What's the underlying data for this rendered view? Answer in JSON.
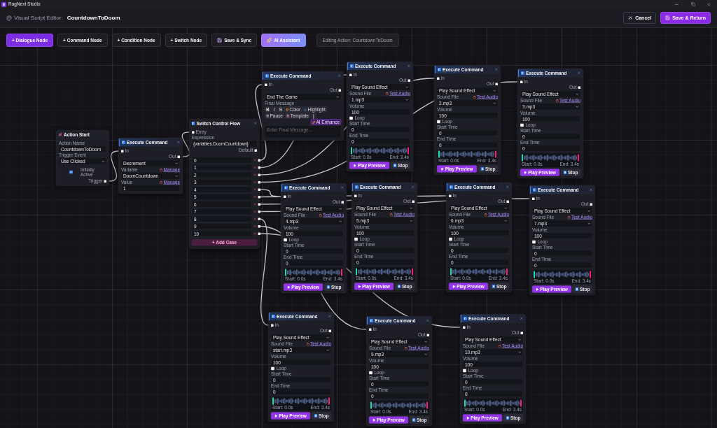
{
  "title_bar": {
    "app_name": "RagNext Studio"
  },
  "header": {
    "label": "Visual Script Editor:",
    "script_name": "CountdownToDoom",
    "buttons": [
      {
        "label": "Cancel",
        "kind": "cancel"
      },
      {
        "label": "Save & Return",
        "kind": "save"
      }
    ]
  },
  "toolbar": {
    "buttons": [
      {
        "label": "+ Dialogue Node",
        "kind": "primary"
      },
      {
        "label": "+ Command Node",
        "kind": "plain"
      },
      {
        "label": "+ Condition Node",
        "kind": "plain"
      },
      {
        "label": "+ Switch Node",
        "kind": "plain"
      },
      {
        "label": "Save & Sync",
        "kind": "save"
      },
      {
        "label": "AI Assistant",
        "kind": "ai"
      }
    ],
    "status": "Editing Action: CountdownToDoom"
  },
  "canvas": {
    "nodes": [
      {
        "kind": "start",
        "title": "Action Start",
        "output": "Trigger",
        "fields": [
          {
            "kind": "input",
            "label": "Action Name",
            "value": "CountdownToDoom"
          },
          {
            "kind": "select",
            "label": "Trigger Event",
            "value": "Use Clicked"
          },
          {
            "kind": "flag",
            "label": "Initially Active",
            "checked": true
          }
        ]
      },
      {
        "kind": "command",
        "title": "Execute Command",
        "input": "In",
        "output": "Out",
        "fields": [
          {
            "kind": "select",
            "value": "Decrement"
          },
          {
            "kind": "select",
            "label": "Variable",
            "link": "Manage",
            "value": "DoomCountdown"
          },
          {
            "kind": "input",
            "label": "Value",
            "link": "Manage",
            "value": "1"
          }
        ]
      },
      {
        "kind": "switch",
        "title": "Switch Control Flow",
        "input": "Entry",
        "default_output": "Default",
        "fields": [
          {
            "kind": "input",
            "label": "Expression",
            "value": "{variables.DoomCountdown}"
          }
        ],
        "cases": [
          "0",
          "1",
          "2",
          "3",
          "4",
          "5",
          "6",
          "7",
          "8",
          "9",
          "10"
        ],
        "add_button": "+ Add Case"
      },
      {
        "kind": "command",
        "title": "Execute Command",
        "input": "In",
        "output": "Out",
        "fields": [
          {
            "kind": "select",
            "value": "End The Game"
          },
          {
            "kind": "rich_text",
            "label": "Final Message",
            "placeholder": "Enter Final Message...",
            "tools": [
              {
                "label": "B",
                "kind": "bold"
              },
              {
                "label": "I",
                "kind": "italic"
              },
              {
                "label": "S",
                "kind": "strike"
              },
              {
                "label": "Color",
                "kind": "color"
              },
              {
                "label": "Highlight",
                "kind": "highlight"
              },
              {
                "label": "Pause",
                "kind": "pause"
              },
              {
                "label": "Template",
                "kind": "template"
              },
              {
                "label": "|",
                "kind": "plain"
              },
              {
                "label": "AI Enhance",
                "kind": "ai"
              }
            ]
          }
        ]
      },
      {
        "kind": "command",
        "title": "Execute Command",
        "input": "In",
        "output": "Out",
        "fields": [
          {
            "kind": "select",
            "value": "Play Sound Effect"
          },
          {
            "kind": "select",
            "label": "Sound File",
            "link": "Test Audio",
            "value": "1.mp3"
          },
          {
            "kind": "input",
            "label": "Volume",
            "value": "100"
          },
          {
            "kind": "checkbox",
            "label": "Loop",
            "checked": false
          },
          {
            "kind": "input",
            "label": "Start Time",
            "value": "0"
          },
          {
            "kind": "input",
            "label": "End Time",
            "value": "0"
          },
          {
            "kind": "waveform",
            "start_label": "Start: 0.0s",
            "end_label": "End: 3.4s"
          },
          {
            "kind": "actions",
            "buttons": [
              {
                "label": "Play Preview",
                "kind": "play"
              },
              {
                "label": "Stop",
                "kind": "stop"
              }
            ]
          }
        ]
      },
      {
        "kind": "command",
        "title": "Execute Command",
        "input": "In",
        "output": "Out",
        "fields": [
          {
            "kind": "select",
            "value": "Play Sound Effect"
          },
          {
            "kind": "select",
            "label": "Sound File",
            "link": "Test Audio",
            "value": "2.mp3"
          },
          {
            "kind": "input",
            "label": "Volume",
            "value": "100"
          },
          {
            "kind": "checkbox",
            "label": "Loop",
            "checked": false
          },
          {
            "kind": "input",
            "label": "Start Time",
            "value": "0"
          },
          {
            "kind": "input",
            "label": "End Time",
            "value": "0"
          },
          {
            "kind": "waveform",
            "start_label": "Start: 0.0s",
            "end_label": "End: 3.4s"
          },
          {
            "kind": "actions",
            "buttons": [
              {
                "label": "Play Preview",
                "kind": "play"
              },
              {
                "label": "Stop",
                "kind": "stop"
              }
            ]
          }
        ]
      },
      {
        "kind": "command",
        "title": "Execute Command",
        "input": "In",
        "output": "Out",
        "fields": [
          {
            "kind": "select",
            "value": "Play Sound Effect"
          },
          {
            "kind": "select",
            "label": "Sound File",
            "link": "Test Audio",
            "value": "3.mp3"
          },
          {
            "kind": "input",
            "label": "Volume",
            "value": "100"
          },
          {
            "kind": "checkbox",
            "label": "Loop",
            "checked": false
          },
          {
            "kind": "input",
            "label": "Start Time",
            "value": "0"
          },
          {
            "kind": "input",
            "label": "End Time",
            "value": "0"
          },
          {
            "kind": "waveform",
            "start_label": "Start: 0.0s",
            "end_label": "End: 3.4s"
          },
          {
            "kind": "actions",
            "buttons": [
              {
                "label": "Play Preview",
                "kind": "play"
              },
              {
                "label": "Stop",
                "kind": "stop"
              }
            ]
          }
        ]
      },
      {
        "kind": "command",
        "title": "Execute Command",
        "input": "In",
        "output": "Out",
        "fields": [
          {
            "kind": "select",
            "value": "Play Sound Effect"
          },
          {
            "kind": "select",
            "label": "Sound File",
            "link": "Test Audio",
            "value": "4.mp3"
          },
          {
            "kind": "input",
            "label": "Volume",
            "value": "100"
          },
          {
            "kind": "checkbox",
            "label": "Loop",
            "checked": false
          },
          {
            "kind": "input",
            "label": "Start Time",
            "value": "0"
          },
          {
            "kind": "input",
            "label": "End Time",
            "value": "0"
          },
          {
            "kind": "waveform",
            "start_label": "Start: 0.0s",
            "end_label": "End: 3.4s"
          },
          {
            "kind": "actions",
            "buttons": [
              {
                "label": "Play Preview",
                "kind": "play"
              },
              {
                "label": "Stop",
                "kind": "stop"
              }
            ]
          }
        ]
      },
      {
        "kind": "command",
        "title": "Execute Command",
        "input": "In",
        "output": "Out",
        "fields": [
          {
            "kind": "select",
            "value": "Play Sound Effect"
          },
          {
            "kind": "select",
            "label": "Sound File",
            "link": "Test Audio",
            "value": "5.mp3"
          },
          {
            "kind": "input",
            "label": "Volume",
            "value": "100"
          },
          {
            "kind": "checkbox",
            "label": "Loop",
            "checked": false
          },
          {
            "kind": "input",
            "label": "Start Time",
            "value": "0"
          },
          {
            "kind": "input",
            "label": "End Time",
            "value": "0"
          },
          {
            "kind": "waveform",
            "start_label": "Start: 0.0s",
            "end_label": "End: 3.4s"
          },
          {
            "kind": "actions",
            "buttons": [
              {
                "label": "Play Preview",
                "kind": "play"
              },
              {
                "label": "Stop",
                "kind": "stop"
              }
            ]
          }
        ]
      },
      {
        "kind": "command",
        "title": "Execute Command",
        "input": "In",
        "output": "Out",
        "fields": [
          {
            "kind": "select",
            "value": "Play Sound Effect"
          },
          {
            "kind": "select",
            "label": "Sound File",
            "link": "Test Audio",
            "value": "6.mp3"
          },
          {
            "kind": "input",
            "label": "Volume",
            "value": "100"
          },
          {
            "kind": "checkbox",
            "label": "Loop",
            "checked": false
          },
          {
            "kind": "input",
            "label": "Start Time",
            "value": "0"
          },
          {
            "kind": "input",
            "label": "End Time",
            "value": "0"
          },
          {
            "kind": "waveform",
            "start_label": "Start: 0.0s",
            "end_label": "End: 3.4s"
          },
          {
            "kind": "actions",
            "buttons": [
              {
                "label": "Play Preview",
                "kind": "play"
              },
              {
                "label": "Stop",
                "kind": "stop"
              }
            ]
          }
        ]
      },
      {
        "kind": "command",
        "title": "Execute Command",
        "input": "In",
        "output": "Out",
        "fields": [
          {
            "kind": "select",
            "value": "Play Sound Effect"
          },
          {
            "kind": "select",
            "label": "Sound File",
            "link": "Test Audio",
            "value": "7.mp3"
          },
          {
            "kind": "input",
            "label": "Volume",
            "value": "100"
          },
          {
            "kind": "checkbox",
            "label": "Loop",
            "checked": false
          },
          {
            "kind": "input",
            "label": "Start Time",
            "value": "0"
          },
          {
            "kind": "input",
            "label": "End Time",
            "value": "0"
          },
          {
            "kind": "waveform",
            "start_label": "Start: 0.0s",
            "end_label": "End: 3.4s"
          },
          {
            "kind": "actions",
            "buttons": [
              {
                "label": "Play Preview",
                "kind": "play"
              },
              {
                "label": "Stop",
                "kind": "stop"
              }
            ]
          }
        ]
      },
      {
        "kind": "command",
        "title": "Execute Command",
        "input": "In",
        "output": "Out",
        "fields": [
          {
            "kind": "select",
            "value": "Play Sound Effect"
          },
          {
            "kind": "select",
            "label": "Sound File",
            "link": "Test Audio",
            "value": "start.mp3"
          },
          {
            "kind": "input",
            "label": "Volume",
            "value": "100"
          },
          {
            "kind": "checkbox",
            "label": "Loop",
            "checked": false
          },
          {
            "kind": "input",
            "label": "Start Time",
            "value": "0"
          },
          {
            "kind": "input",
            "label": "End Time",
            "value": "0"
          },
          {
            "kind": "waveform",
            "start_label": "Start: 0.0s",
            "end_label": "End: 3.4s"
          },
          {
            "kind": "actions",
            "buttons": [
              {
                "label": "Play Preview",
                "kind": "play"
              },
              {
                "label": "Stop",
                "kind": "stop"
              }
            ]
          }
        ]
      },
      {
        "kind": "command",
        "title": "Execute Command",
        "input": "In",
        "output": "Out",
        "fields": [
          {
            "kind": "select",
            "value": "Play Sound Effect"
          },
          {
            "kind": "select",
            "label": "Sound File",
            "link": "Test Audio",
            "value": "9.mp3"
          },
          {
            "kind": "input",
            "label": "Volume",
            "value": "100"
          },
          {
            "kind": "checkbox",
            "label": "Loop",
            "checked": false
          },
          {
            "kind": "input",
            "label": "Start Time",
            "value": "0"
          },
          {
            "kind": "input",
            "label": "End Time",
            "value": "0"
          },
          {
            "kind": "waveform",
            "start_label": "Start: 0.0s",
            "end_label": "End: 3.4s"
          },
          {
            "kind": "actions",
            "buttons": [
              {
                "label": "Play Preview",
                "kind": "play"
              },
              {
                "label": "Stop",
                "kind": "stop"
              }
            ]
          }
        ]
      },
      {
        "kind": "command",
        "title": "Execute Command",
        "input": "In",
        "output": "Out",
        "fields": [
          {
            "kind": "select",
            "value": "Play Sound Effect"
          },
          {
            "kind": "select",
            "label": "Sound File",
            "link": "Test Audio",
            "value": "10.mp3"
          },
          {
            "kind": "input",
            "label": "Volume",
            "value": "100"
          },
          {
            "kind": "checkbox",
            "label": "Loop",
            "checked": false
          },
          {
            "kind": "input",
            "label": "Start Time",
            "value": "0"
          },
          {
            "kind": "input",
            "label": "End Time",
            "value": "0"
          },
          {
            "kind": "waveform",
            "start_label": "Start: 0.0s",
            "end_label": "End: 3.4s"
          },
          {
            "kind": "actions",
            "buttons": [
              {
                "label": "Play Preview",
                "kind": "play"
              },
              {
                "label": "Stop",
                "kind": "stop"
              }
            ]
          }
        ]
      }
    ]
  }
}
